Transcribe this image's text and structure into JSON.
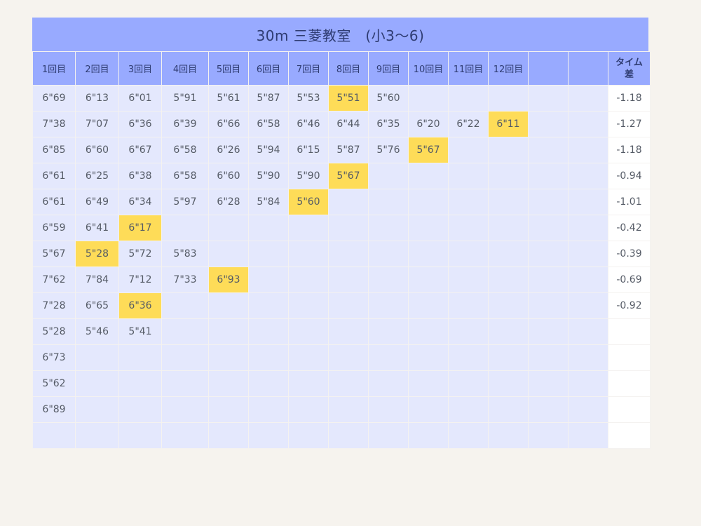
{
  "title": "30m 三菱教室　(小3〜6)",
  "colors": {
    "header_bg": "#98aaff",
    "cell_bg": "#e4e8fd",
    "best_bg": "#fedc58",
    "diff_bg": "#ffffff"
  },
  "headers": [
    "1回目",
    "2回目",
    "3回目",
    "4回目",
    "5回目",
    "6回目",
    "7回目",
    "8回目",
    "9回目",
    "10回目",
    "11回目",
    "12回目",
    "",
    "",
    "タイム差"
  ],
  "rows": [
    {
      "times": [
        "6\"69",
        "6\"13",
        "6\"01",
        "5\"91",
        "5\"61",
        "5\"87",
        "5\"53",
        "5\"51",
        "5\"60",
        "",
        "",
        "",
        "",
        ""
      ],
      "best": 7,
      "diff": "-1.18"
    },
    {
      "times": [
        "7\"38",
        "7\"07",
        "6\"36",
        "6\"39",
        "6\"66",
        "6\"58",
        "6\"46",
        "6\"44",
        "6\"35",
        "6\"20",
        "6\"22",
        "6\"11",
        "",
        ""
      ],
      "best": 11,
      "diff": "-1.27"
    },
    {
      "times": [
        "6\"85",
        "6\"60",
        "6\"67",
        "6\"58",
        "6\"26",
        "5\"94",
        "6\"15",
        "5\"87",
        "5\"76",
        "5\"67",
        "",
        "",
        "",
        ""
      ],
      "best": 9,
      "diff": "-1.18"
    },
    {
      "times": [
        "6\"61",
        "6\"25",
        "6\"38",
        "6\"58",
        "6\"60",
        "5\"90",
        "5\"90",
        "5\"67",
        "",
        "",
        "",
        "",
        "",
        ""
      ],
      "best": 7,
      "diff": "-0.94"
    },
    {
      "times": [
        "6\"61",
        "6\"49",
        "6\"34",
        "5\"97",
        "6\"28",
        "5\"84",
        "5\"60",
        "",
        "",
        "",
        "",
        "",
        "",
        ""
      ],
      "best": 6,
      "diff": "-1.01"
    },
    {
      "times": [
        "6\"59",
        "6\"41",
        "6\"17",
        "",
        "",
        "",
        "",
        "",
        "",
        "",
        "",
        "",
        "",
        ""
      ],
      "best": 2,
      "diff": "-0.42"
    },
    {
      "times": [
        "5\"67",
        "5\"28",
        "5\"72",
        "5\"83",
        "",
        "",
        "",
        "",
        "",
        "",
        "",
        "",
        "",
        ""
      ],
      "best": 1,
      "diff": "-0.39"
    },
    {
      "times": [
        "7\"62",
        "7\"84",
        "7\"12",
        "7\"33",
        "6\"93",
        "",
        "",
        "",
        "",
        "",
        "",
        "",
        "",
        ""
      ],
      "best": 4,
      "diff": "-0.69"
    },
    {
      "times": [
        "7\"28",
        "6\"65",
        "6\"36",
        "",
        "",
        "",
        "",
        "",
        "",
        "",
        "",
        "",
        "",
        ""
      ],
      "best": 2,
      "diff": "-0.92"
    },
    {
      "times": [
        "5\"28",
        "5\"46",
        "5\"41",
        "",
        "",
        "",
        "",
        "",
        "",
        "",
        "",
        "",
        "",
        ""
      ],
      "best": -1,
      "diff": ""
    },
    {
      "times": [
        "6\"73",
        "",
        "",
        "",
        "",
        "",
        "",
        "",
        "",
        "",
        "",
        "",
        "",
        ""
      ],
      "best": -1,
      "diff": ""
    },
    {
      "times": [
        "5\"62",
        "",
        "",
        "",
        "",
        "",
        "",
        "",
        "",
        "",
        "",
        "",
        "",
        ""
      ],
      "best": -1,
      "diff": ""
    },
    {
      "times": [
        "6\"89",
        "",
        "",
        "",
        "",
        "",
        "",
        "",
        "",
        "",
        "",
        "",
        "",
        ""
      ],
      "best": -1,
      "diff": ""
    },
    {
      "times": [
        "",
        "",
        "",
        "",
        "",
        "",
        "",
        "",
        "",
        "",
        "",
        "",
        "",
        ""
      ],
      "best": -1,
      "diff": ""
    }
  ]
}
